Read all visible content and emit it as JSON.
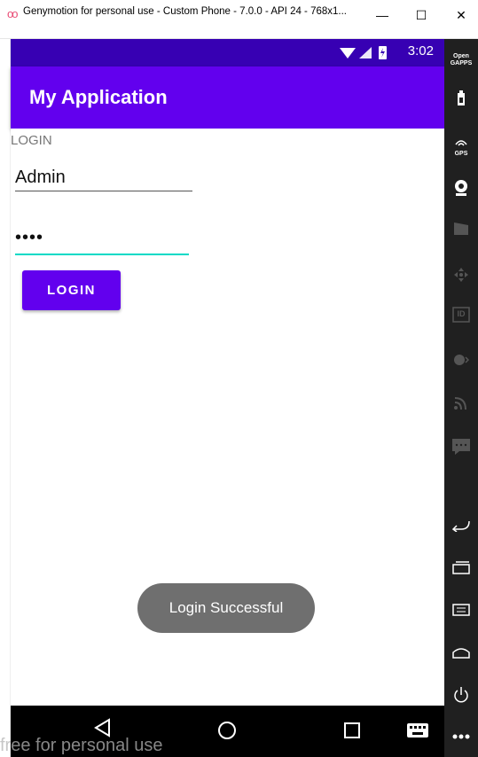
{
  "window": {
    "title": "Genymotion for personal use - Custom Phone - 7.0.0 - API 24 - 768x1...",
    "minimize": "—",
    "maximize": "☐",
    "close": "✕"
  },
  "statusbar": {
    "time": "3:02"
  },
  "appbar": {
    "title": "My Application"
  },
  "main": {
    "login_label": "LOGIN",
    "username_value": "Admin",
    "password_value": "••••",
    "login_button": "LOGIN"
  },
  "toast": {
    "text": "Login Successful"
  },
  "sidebar": {
    "open_gapps_label": "Open GAPPS",
    "gps_label": "GPS",
    "id_label": "ID",
    "items": [
      "open-gapps-icon",
      "battery-icon",
      "gps-icon",
      "camera-icon",
      "clapper-icon",
      "move-icon",
      "id-icon",
      "media-icon",
      "cast-icon",
      "chat-icon",
      "back-icon",
      "recents-icon",
      "menu-icon",
      "home-icon",
      "power-icon",
      "more-icon"
    ]
  },
  "watermark": "free for personal use",
  "colors": {
    "primary": "#6200ee",
    "primary_dark": "#3700b3",
    "accent": "#03dac6"
  }
}
